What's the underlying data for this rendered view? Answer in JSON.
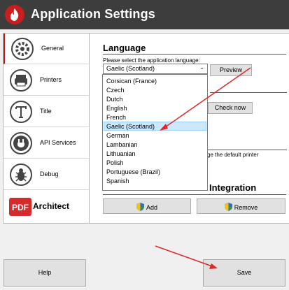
{
  "window": {
    "title": "Application Settings",
    "logo_icon": "flame-icon"
  },
  "sidebar": {
    "items": [
      {
        "label": "General",
        "icon": "gear-icon",
        "active": true
      },
      {
        "label": "Printers",
        "icon": "printer-icon",
        "active": false
      },
      {
        "label": "Title",
        "icon": "title-icon",
        "active": false
      },
      {
        "label": "API Services",
        "icon": "plug-icon",
        "active": false
      },
      {
        "label": "Debug",
        "icon": "bug-icon",
        "active": false
      }
    ],
    "brand": {
      "mark": "PDF",
      "name": "Architect"
    }
  },
  "language": {
    "heading": "Language",
    "hint": "Please select the application language:",
    "selected": "Gaelic (Scotland)",
    "preview_label": "Preview",
    "options": [
      "Corsican (France)",
      "Czech",
      "Dutch",
      "English",
      "French",
      "Gaelic (Scotland)",
      "German",
      "Lambanian",
      "Lithuanian",
      "Polish",
      "Portuguese (Brazil)",
      "Spanish"
    ],
    "highlighted": "Gaelic (Scotland)"
  },
  "updates": {
    "check_label": "Check now"
  },
  "printer": {
    "partial_text": "ge the default printer"
  },
  "integration": {
    "heading_partial": "Integration",
    "add_label": "Add",
    "remove_label": "Remove"
  },
  "footer": {
    "help_label": "Help",
    "save_label": "Save"
  },
  "colors": {
    "titlebar": "#3d3d3d",
    "accent_red": "#e22727",
    "highlight": "#cce8ff"
  }
}
